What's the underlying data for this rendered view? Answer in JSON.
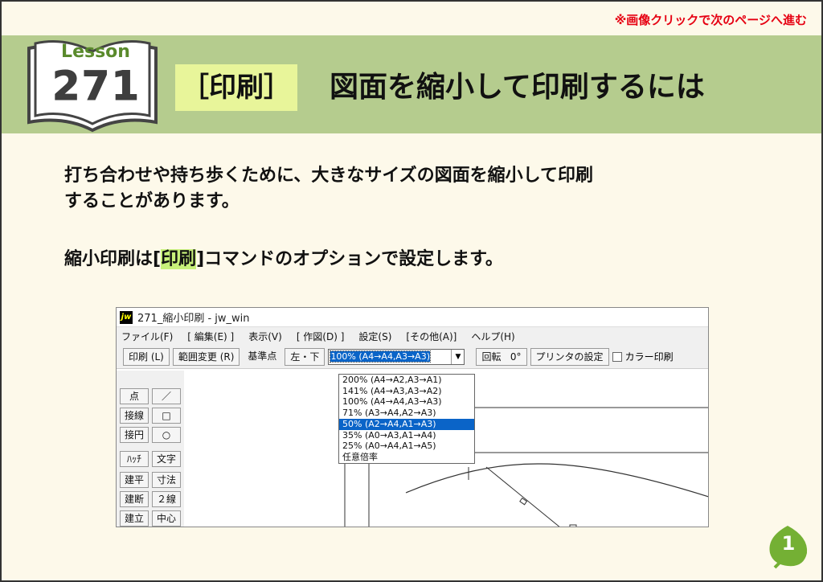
{
  "nav_hint": "※画像クリックで次のページへ進む",
  "lesson": {
    "label": "Lesson",
    "number": "271"
  },
  "category": "［印刷］",
  "title": "図面を縮小して印刷するには",
  "intro_line1": "打ち合わせや持ち歩くために、大きなサイズの図面を縮小して印刷",
  "intro_line2": "することがあります。",
  "command": {
    "before": "縮小印刷は[",
    "highlight": "印刷",
    "after": "]コマンドのオプションで設定します。"
  },
  "window": {
    "icon": "jw",
    "title": "271_縮小印刷 - jw_win",
    "menu": [
      "ファイル(F)",
      "[ 編集(E) ]",
      "表示(V)",
      "[ 作図(D) ]",
      "設定(S)",
      "[その他(A)]",
      "ヘルプ(H)"
    ],
    "toolbar": {
      "print": "印刷 (L)",
      "range": "範囲変更 (R)",
      "basepoint_label": "基準点",
      "basepoint_value": "左・下",
      "scale_selected": "100% (A4→A4,A3→A3)",
      "rotate_label": "回転",
      "rotate_value": "0°",
      "printer_settings": "プリンタの設定",
      "color_print": "カラー印刷"
    },
    "scale_options": [
      "200% (A4→A2,A3→A1)",
      "141% (A4→A3,A3→A2)",
      "100% (A4→A4,A3→A3)",
      " 71% (A3→A4,A2→A3)",
      " 50% (A2→A4,A1→A3)",
      " 35% (A0→A3,A1→A4)",
      " 25% (A0→A4,A1→A5)",
      "任意倍率"
    ],
    "tools_left": [
      "点",
      "接線",
      "接円",
      "ﾊｯﾁ",
      "建平",
      "建断",
      "建立"
    ],
    "tools_right": [
      "／",
      "□",
      "○",
      "文字",
      "寸法",
      "２線",
      "中心線"
    ]
  },
  "page_number": "1",
  "colors": {
    "banner": "#b5cc8e",
    "highlight": "#e8f59a",
    "hint": "#e60012",
    "selection": "#0a64c8"
  }
}
